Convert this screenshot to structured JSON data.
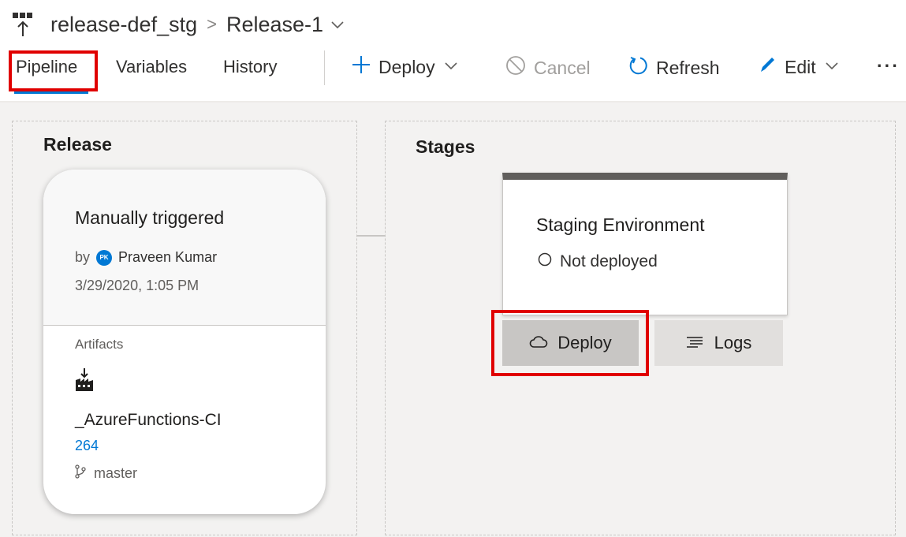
{
  "header": {
    "pipeline_name": "release-def_stg",
    "separator": ">",
    "release_name": "Release-1"
  },
  "tabs": [
    {
      "label": "Pipeline",
      "active": true
    },
    {
      "label": "Variables"
    },
    {
      "label": "History"
    }
  ],
  "toolbar": {
    "deploy_label": "Deploy",
    "cancel_label": "Cancel",
    "refresh_label": "Refresh",
    "edit_label": "Edit",
    "more_label": "···"
  },
  "release_panel": {
    "title": "Release",
    "card": {
      "trigger": "Manually triggered",
      "by_label": "by",
      "avatar_initials": "PK",
      "user": "Praveen Kumar",
      "timestamp": "3/29/2020, 1:05 PM",
      "artifacts_label": "Artifacts",
      "artifact_name": "_AzureFunctions-CI",
      "build_number": "264",
      "branch": "master"
    }
  },
  "stages_panel": {
    "title": "Stages",
    "stage": {
      "name": "Staging Environment",
      "status": "Not deployed"
    },
    "deploy_label": "Deploy",
    "logs_label": "Logs"
  },
  "colors": {
    "accent": "#0078d4",
    "highlight": "#e00000",
    "stage_bar": "#605e5c"
  }
}
